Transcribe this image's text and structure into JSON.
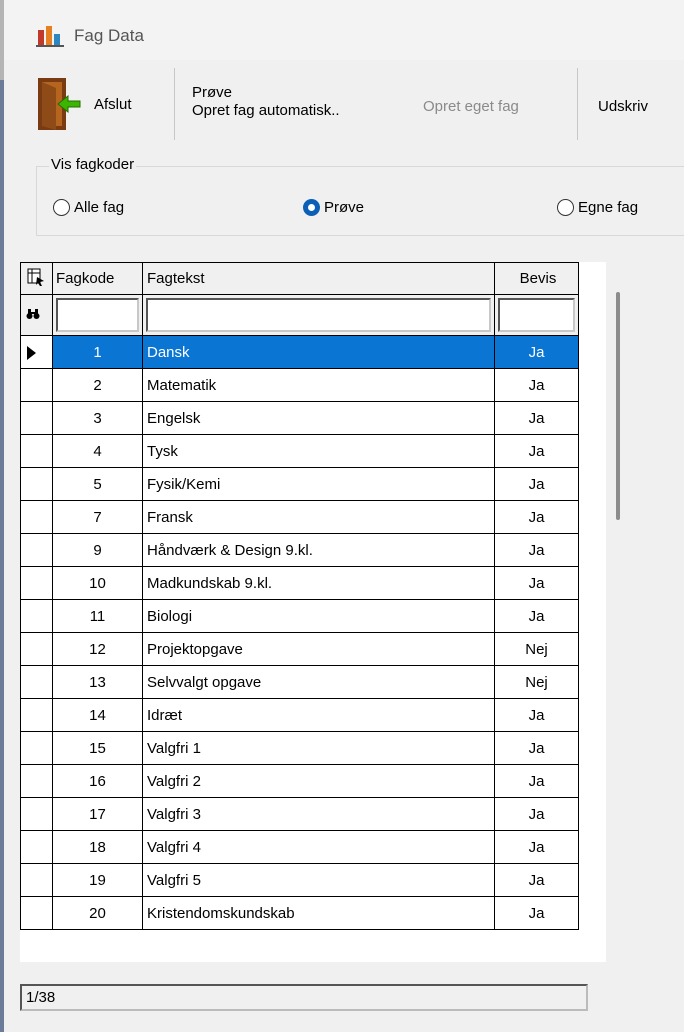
{
  "window": {
    "title": "Fag Data"
  },
  "toolbar": {
    "exit_label": "Afslut",
    "prove_label": "Prøve",
    "create_auto_label": "Opret fag automatisk..",
    "create_own_label": "Opret eget fag",
    "print_label": "Udskriv"
  },
  "filter": {
    "legend": "Vis fagkoder",
    "options": [
      {
        "label": "Alle fag",
        "checked": false
      },
      {
        "label": "Prøve",
        "checked": true
      },
      {
        "label": "Egne fag",
        "checked": false
      }
    ]
  },
  "grid": {
    "columns": [
      "Fagkode",
      "Fagtekst",
      "Bevis"
    ],
    "rows": [
      {
        "code": "1",
        "text": "Dansk",
        "proof": "Ja"
      },
      {
        "code": "2",
        "text": "Matematik",
        "proof": "Ja"
      },
      {
        "code": "3",
        "text": "Engelsk",
        "proof": "Ja"
      },
      {
        "code": "4",
        "text": "Tysk",
        "proof": "Ja"
      },
      {
        "code": "5",
        "text": "Fysik/Kemi",
        "proof": "Ja"
      },
      {
        "code": "7",
        "text": "Fransk",
        "proof": "Ja"
      },
      {
        "code": "9",
        "text": "Håndværk & Design 9.kl.",
        "proof": "Ja"
      },
      {
        "code": "10",
        "text": "Madkundskab 9.kl.",
        "proof": "Ja"
      },
      {
        "code": "11",
        "text": "Biologi",
        "proof": "Ja"
      },
      {
        "code": "12",
        "text": "Projektopgave",
        "proof": "Nej"
      },
      {
        "code": "13",
        "text": "Selvvalgt opgave",
        "proof": "Nej"
      },
      {
        "code": "14",
        "text": "Idræt",
        "proof": "Ja"
      },
      {
        "code": "15",
        "text": "Valgfri 1",
        "proof": "Ja"
      },
      {
        "code": "16",
        "text": "Valgfri 2",
        "proof": "Ja"
      },
      {
        "code": "17",
        "text": "Valgfri 3",
        "proof": "Ja"
      },
      {
        "code": "18",
        "text": "Valgfri 4",
        "proof": "Ja"
      },
      {
        "code": "19",
        "text": "Valgfri 5",
        "proof": "Ja"
      },
      {
        "code": "20",
        "text": "Kristendomskundskab",
        "proof": "Ja"
      }
    ],
    "selected_index": 0
  },
  "status": {
    "record": "1/38"
  },
  "colors": {
    "selection": "#0a75d2",
    "radio_checked": "#0a5fb6",
    "disabled_text": "#8a8a8a"
  }
}
